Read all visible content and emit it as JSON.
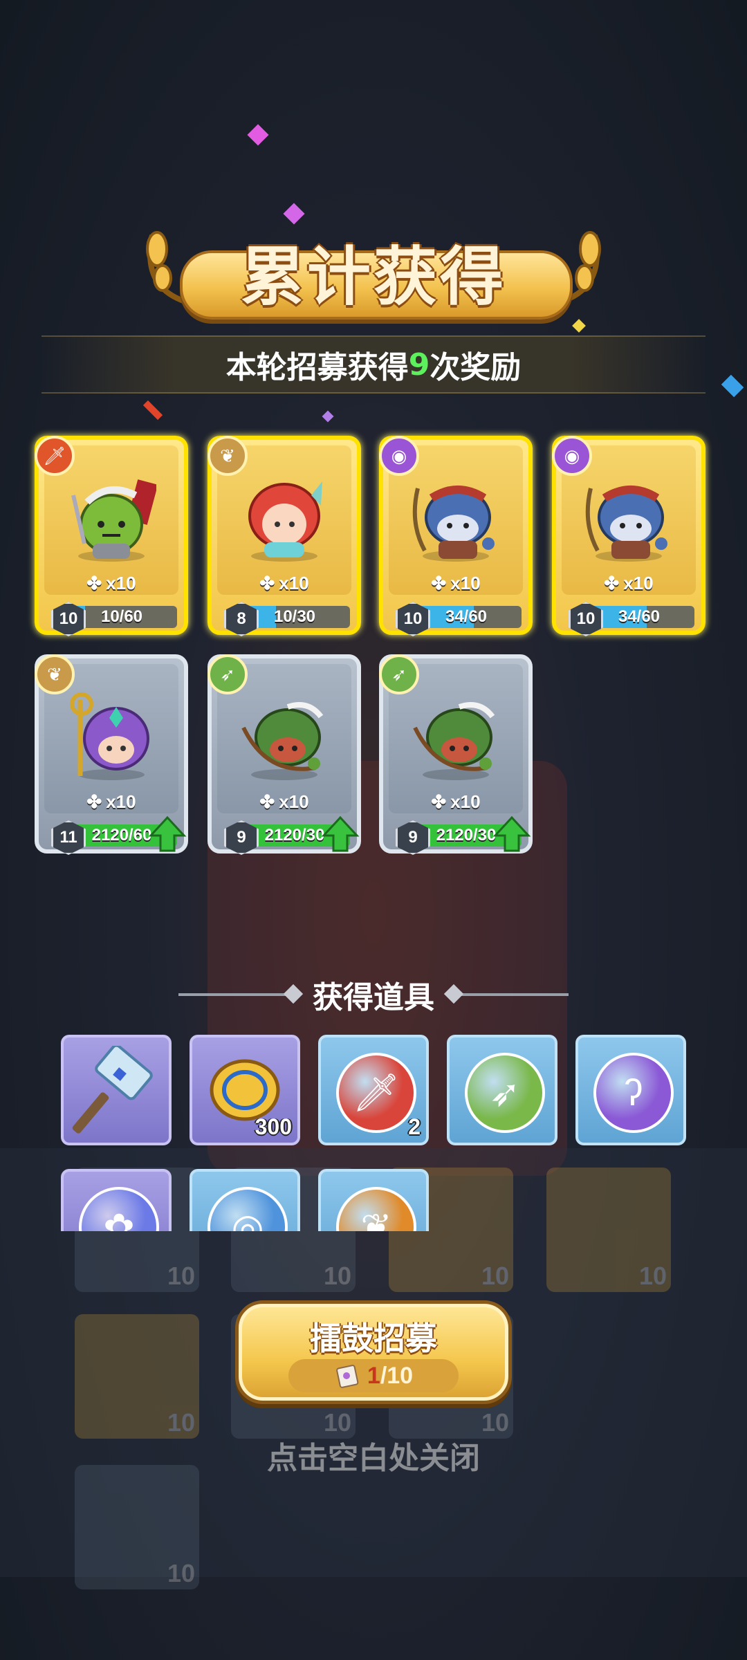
{
  "title": "累计获得",
  "subtitle": {
    "prefix": "本轮招募获得",
    "count": "9",
    "suffix": "次奖励"
  },
  "heroes": [
    {
      "style": "gold",
      "class_icon": "sword-icon",
      "class_color": "#e0552a",
      "fragments": "x10",
      "level": "10",
      "progress": "10/60",
      "progress_fraction": 0.17,
      "hero": "green-orc-warrior"
    },
    {
      "style": "gold",
      "class_icon": "wings-icon",
      "class_color": "#c99a4a",
      "fragments": "x10",
      "level": "8",
      "progress": "10/30",
      "progress_fraction": 0.33,
      "hero": "red-haired-mermaid"
    },
    {
      "style": "gold",
      "class_icon": "eye-icon",
      "class_color": "#9a55d6",
      "fragments": "x10",
      "level": "10",
      "progress": "34/60",
      "progress_fraction": 0.57,
      "hero": "blue-shark-archer"
    },
    {
      "style": "gold",
      "class_icon": "eye-icon",
      "class_color": "#9a55d6",
      "fragments": "x10",
      "level": "10",
      "progress": "34/60",
      "progress_fraction": 0.57,
      "hero": "blue-shark-archer"
    },
    {
      "style": "gray",
      "class_icon": "wings-icon",
      "class_color": "#c99a4a",
      "fragments": "x10",
      "level": "11",
      "progress": "2120/60",
      "progress_fraction": 1,
      "hero": "purple-priestess",
      "upgrade": true
    },
    {
      "style": "gray",
      "class_icon": "bow-icon",
      "class_color": "#6fb24a",
      "fragments": "x10",
      "level": "9",
      "progress": "2120/30",
      "progress_fraction": 1,
      "hero": "green-hood-archer",
      "upgrade": true
    },
    {
      "style": "gray",
      "class_icon": "bow-icon",
      "class_color": "#6fb24a",
      "fragments": "x10",
      "level": "9",
      "progress": "2120/30",
      "progress_fraction": 1,
      "hero": "green-hood-archer",
      "upgrade": true
    }
  ],
  "items_heading": "获得道具",
  "items": [
    {
      "style": "purple",
      "icon": "hammer-icon",
      "qty": ""
    },
    {
      "style": "purple",
      "icon": "gold-coin-icon",
      "qty": "300"
    },
    {
      "style": "blue",
      "icon": "sword-orb-icon",
      "qty": "2",
      "color": "#d9453a"
    },
    {
      "style": "blue",
      "icon": "bow-orb-icon",
      "qty": "",
      "color": "#7ab84a"
    },
    {
      "style": "blue",
      "icon": "hook-orb-icon",
      "qty": "",
      "color": "#8b58d6"
    },
    {
      "style": "purple",
      "icon": "paw-orb-icon",
      "qty": "",
      "color": "#6b7ae6"
    },
    {
      "style": "blue",
      "icon": "swirl-orb-icon",
      "qty": "",
      "color": "#4f93dc"
    },
    {
      "style": "blue",
      "icon": "wings-orb-icon",
      "qty": "",
      "color": "#e08a2a"
    }
  ],
  "background_tiles": [
    "10",
    "10",
    "10",
    "10",
    "10",
    "10",
    "10",
    "10"
  ],
  "recruit": {
    "label": "擂鼓招募",
    "current": "1",
    "total": "/10"
  },
  "close_hint": "点击空白处关闭"
}
